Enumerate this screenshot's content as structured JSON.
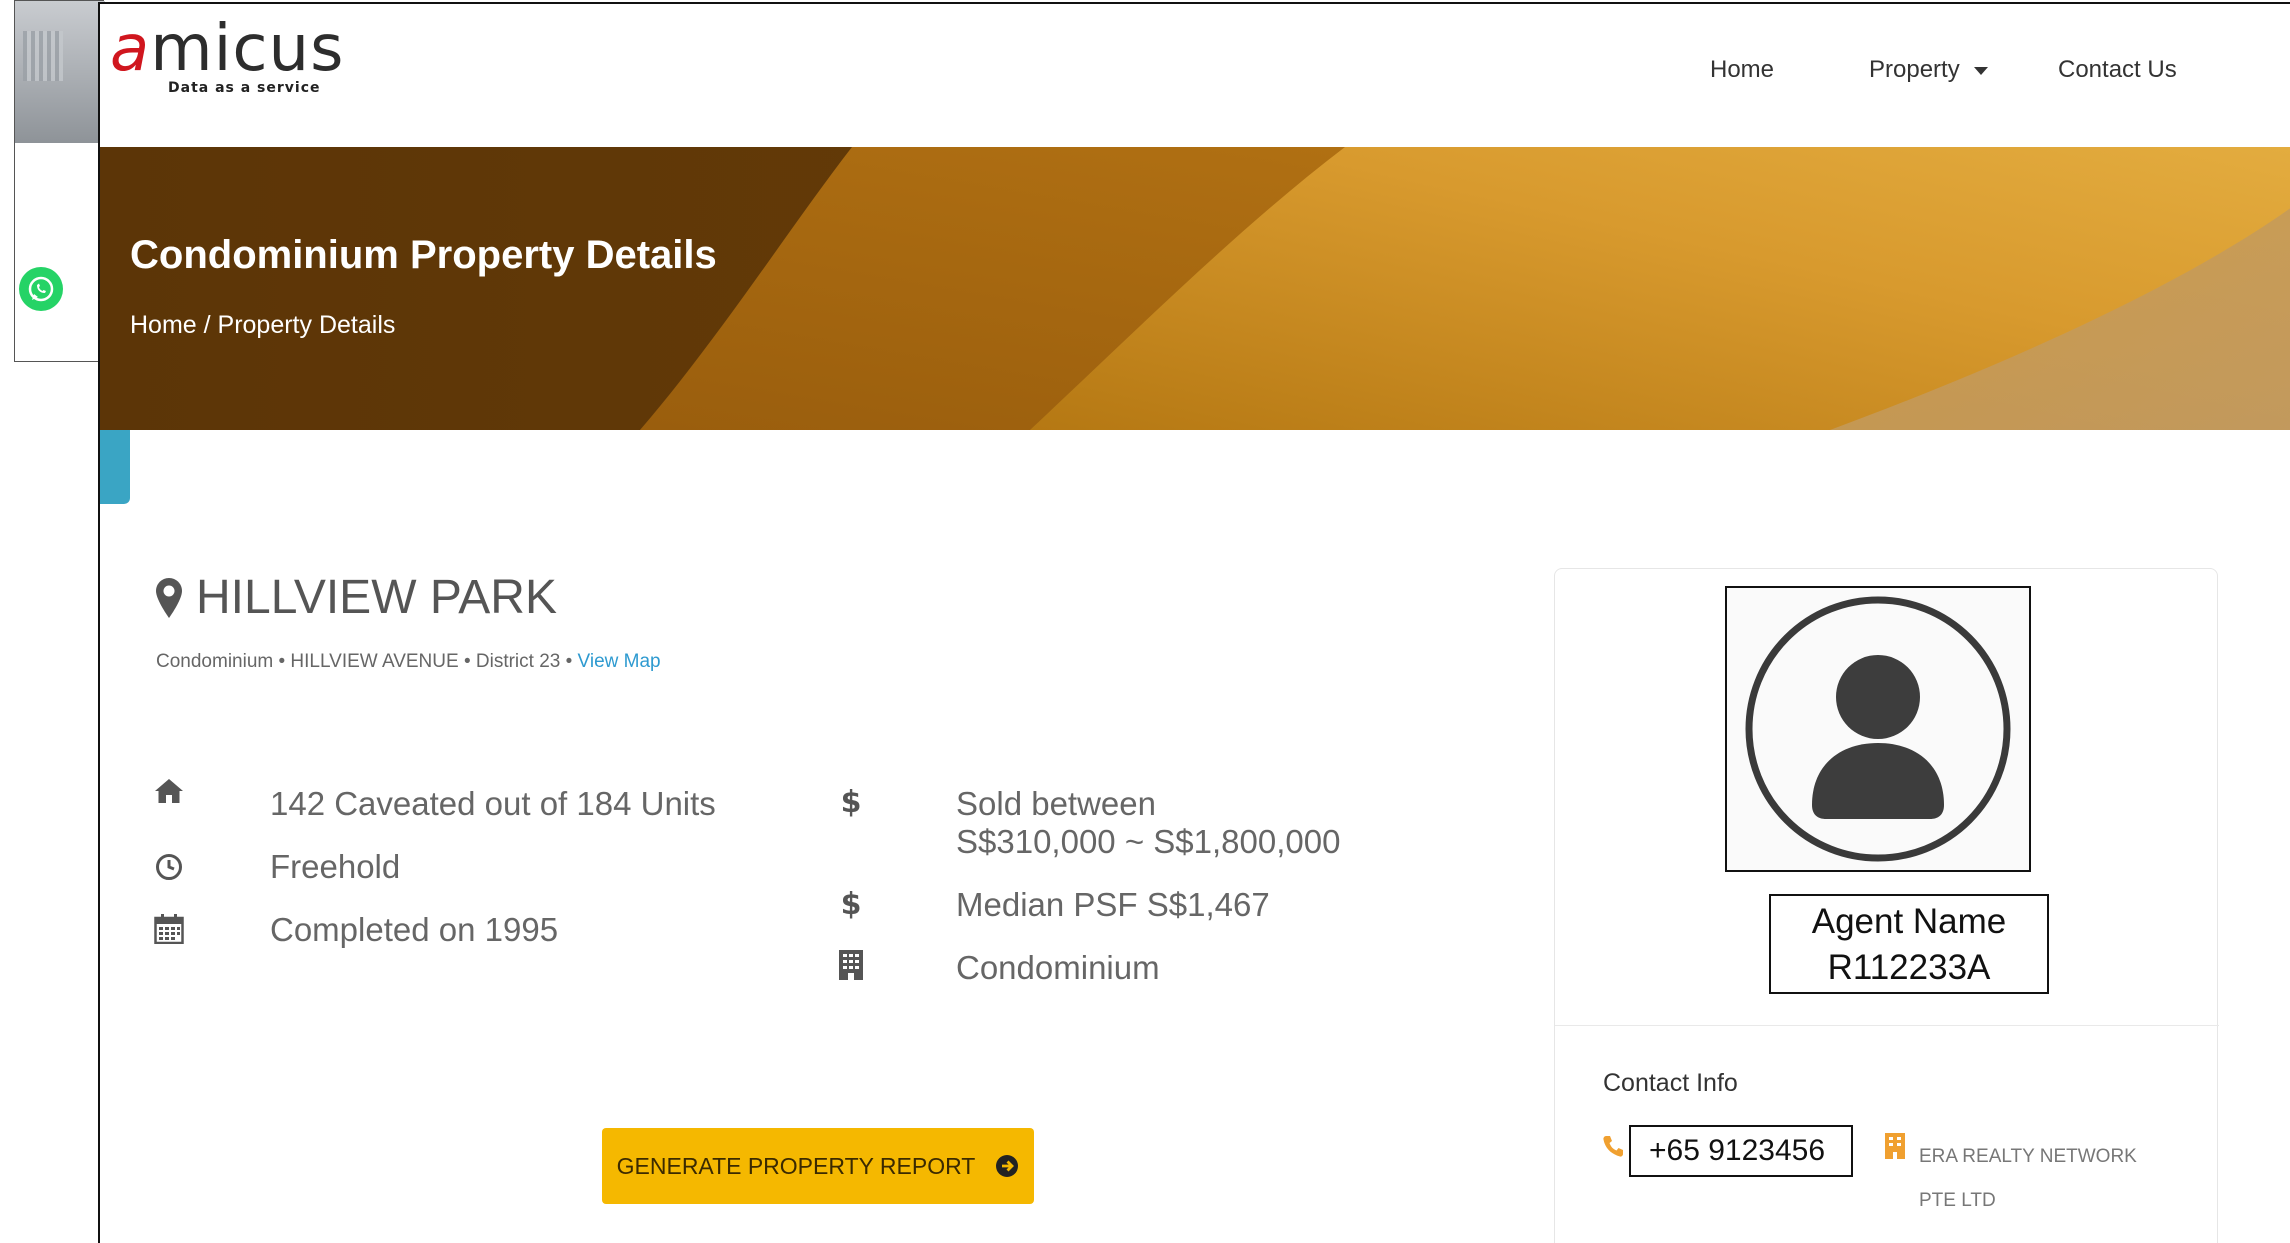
{
  "brand": {
    "name_accent": "a",
    "name_rest": "micus",
    "tagline": "Data as a service",
    "accent_color": "#d0161e"
  },
  "nav": {
    "items": [
      "Home",
      "Property",
      "Contact Us"
    ]
  },
  "banner": {
    "title": "Condominium Property Details",
    "breadcrumb": "Home / Property Details"
  },
  "property": {
    "name": "HILLVIEW PARK",
    "meta": "Condominium • HILLVIEW AVENUE • District 23 • ",
    "view_map": "View Map",
    "features_left": [
      {
        "icon": "home-icon",
        "text": "142 Caveated out of 184 Units"
      },
      {
        "icon": "clock-icon",
        "text": "Freehold"
      },
      {
        "icon": "calendar-icon",
        "text": "Completed on 1995"
      }
    ],
    "features_right": [
      {
        "icon": "dollar-icon",
        "line1": "Sold between",
        "line2": "S$310,000 ~ S$1,800,000"
      },
      {
        "icon": "dollar-icon",
        "line1": "Median PSF S$1,467"
      },
      {
        "icon": "building-icon",
        "line1": "Condominium"
      }
    ],
    "report_button": "GENERATE PROPERTY REPORT"
  },
  "agent": {
    "name": "Agent Name",
    "registration": "R112233A",
    "contact_heading": "Contact Info",
    "phone": "+65 9123456",
    "agency": "ERA REALTY NETWORK PTE LTD"
  },
  "colors": {
    "button": "#f5b800",
    "link": "#2e9ad0",
    "banner_dark": "#5a3608",
    "banner_light": "#d89a2e"
  }
}
